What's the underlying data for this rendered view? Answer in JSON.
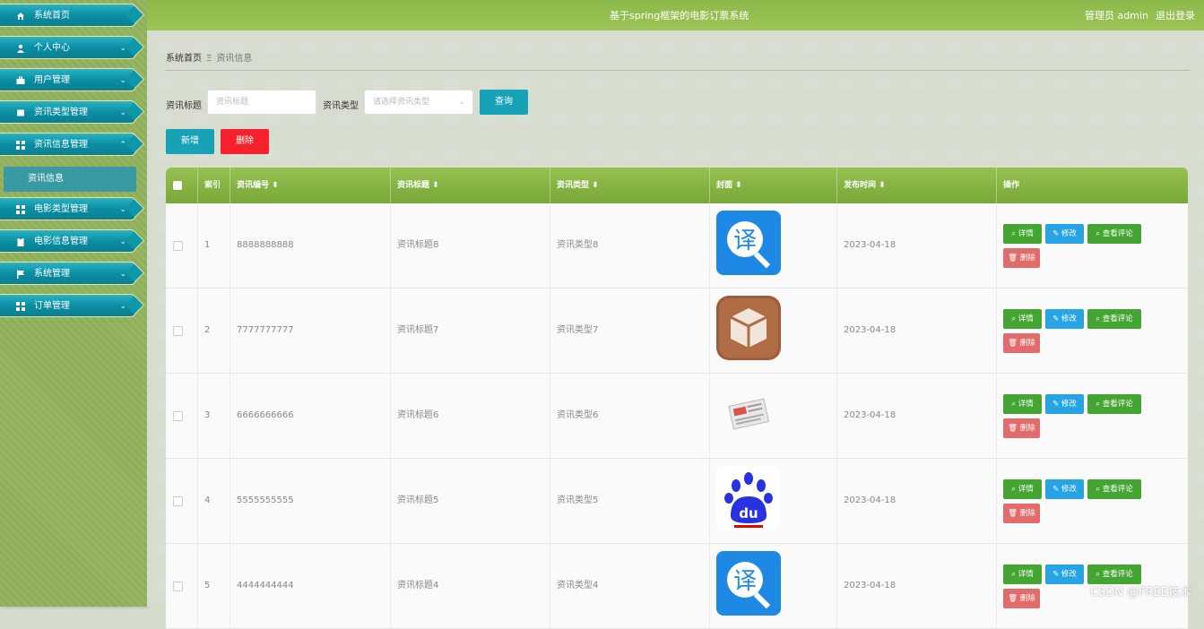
{
  "header": {
    "title": "基于spring框架的电影订票系统",
    "user": "管理员 admin",
    "logout": "退出登录"
  },
  "sidebar": {
    "items": [
      {
        "label": "系统首页",
        "icon": "home-icon"
      },
      {
        "label": "个人中心",
        "icon": "user-icon"
      },
      {
        "label": "用户管理",
        "icon": "briefcase-icon"
      },
      {
        "label": "资讯类型管理",
        "icon": "card-icon"
      },
      {
        "label": "资讯信息管理",
        "icon": "grid-icon"
      },
      {
        "label": "电影类型管理",
        "icon": "grid-icon"
      },
      {
        "label": "电影信息管理",
        "icon": "clipboard-icon"
      },
      {
        "label": "系统管理",
        "icon": "flag-icon"
      },
      {
        "label": "订单管理",
        "icon": "grid-icon"
      }
    ],
    "submenu": "资讯信息"
  },
  "breadcrumb": {
    "home": "系统首页",
    "current": "资讯信息"
  },
  "search": {
    "title_label": "资讯标题",
    "title_placeholder": "资讯标题",
    "type_label": "资讯类型",
    "type_placeholder": "请选择资讯类型",
    "query_button": "查询"
  },
  "toolbar": {
    "add": "新增",
    "delete": "删除"
  },
  "table": {
    "headers": [
      "索引",
      "资讯编号",
      "资讯标题",
      "资讯类型",
      "封面",
      "发布时间",
      "操作"
    ],
    "actions": {
      "detail": "详情",
      "edit": "修改",
      "comments": "查看评论",
      "delete": "删除"
    },
    "rows": [
      {
        "index": "1",
        "code": "8888888888",
        "title": "资讯标题8",
        "type": "资讯类型8",
        "cover": "translate-app-icon",
        "date": "2023-04-18"
      },
      {
        "index": "2",
        "code": "7777777777",
        "title": "资讯标题7",
        "type": "资讯类型7",
        "cover": "package-app-icon",
        "date": "2023-04-18"
      },
      {
        "index": "3",
        "code": "6666666666",
        "title": "资讯标题6",
        "type": "资讯类型6",
        "cover": "newspaper-icon",
        "date": "2023-04-18"
      },
      {
        "index": "4",
        "code": "5555555555",
        "title": "资讯标题5",
        "type": "资讯类型5",
        "cover": "baidu-paw-icon",
        "date": "2023-04-18"
      },
      {
        "index": "5",
        "code": "4444444444",
        "title": "资讯标题4",
        "type": "资讯类型4",
        "cover": "translate-app-icon",
        "date": "2023-04-18"
      }
    ]
  },
  "watermark": "CSDN @FREE技术",
  "colors": {
    "teal": "#17a2b8",
    "red": "#f5222d",
    "green": "#45a533",
    "blue": "#27a4e6",
    "header_green": "#8db94a"
  }
}
